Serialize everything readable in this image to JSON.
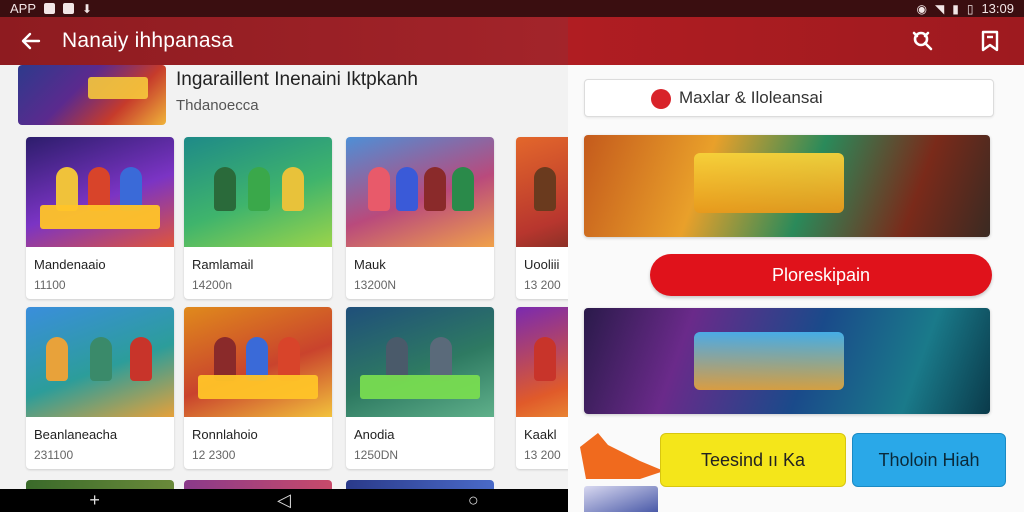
{
  "status_bar": {
    "left_text": "APP",
    "time": "13:09"
  },
  "left_pane": {
    "title": "Nanaiy ihhpanasa",
    "featured": {
      "title": "Ingaraillent Inenaini Iktpkanh",
      "subtitle": "Thdanoecca"
    },
    "cards": [
      {
        "name": "Mandenaaio",
        "meta": "11100"
      },
      {
        "name": "Ramlamail",
        "meta": "14200n"
      },
      {
        "name": "Mauk",
        "meta": "13200N"
      },
      {
        "name": "Uooliii",
        "meta": "13 200"
      },
      {
        "name": "Beanlaneacha",
        "meta": "231100"
      },
      {
        "name": "Ronnlahoio",
        "meta": "12 2300"
      },
      {
        "name": "Anodia",
        "meta": "1250DN"
      },
      {
        "name": "Kaakl",
        "meta": "13 200"
      }
    ]
  },
  "nav_bar": {
    "add": "+",
    "back": "◁",
    "home": "○"
  },
  "right_pane": {
    "search_value": "Maxlar & Iloleansai",
    "cta_red": "Ploreskipain",
    "cta_yellow": "Teesind ıı Ka",
    "cta_blue": "Tholoin Hiah"
  },
  "colors": {
    "accent_red": "#a3242a",
    "cta_red": "#e0121b",
    "cta_yellow": "#f4e61a",
    "cta_blue": "#2aa8e8"
  },
  "icons": [
    "back-arrow-icon",
    "search-icon",
    "bookmark-icon",
    "signal-icon",
    "wifi-icon",
    "battery-icon",
    "pointer-arrow-icon"
  ]
}
